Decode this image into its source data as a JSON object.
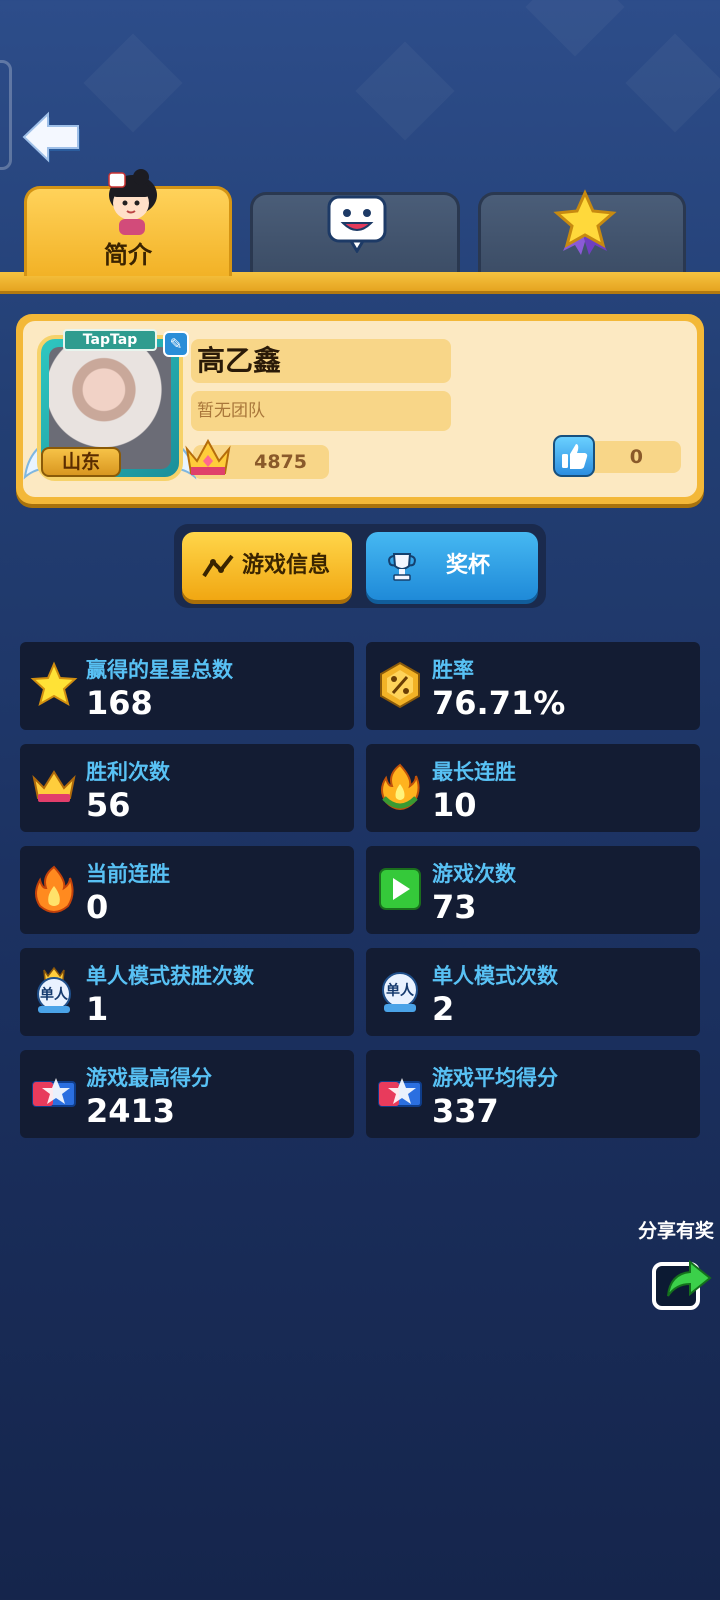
{
  "tabs": [
    {
      "label": "简介",
      "active": true,
      "icon": "character-avatar-icon"
    },
    {
      "label": "",
      "active": false,
      "icon": "smiley-chat-icon"
    },
    {
      "label": "",
      "active": false,
      "icon": "star-medal-icon"
    }
  ],
  "profile": {
    "platform_tag": "TapTap",
    "name": "高乙鑫",
    "team": "暂无团队",
    "region": "山东",
    "crowns": "4875",
    "likes": "0"
  },
  "subtabs": {
    "game_info": "游戏信息",
    "trophies": "奖杯"
  },
  "stats": [
    {
      "label": "赢得的星星总数",
      "value": "168",
      "icon": "star-icon"
    },
    {
      "label": "胜率",
      "value": "76.71%",
      "icon": "percent-badge-icon"
    },
    {
      "label": "胜利次数",
      "value": "56",
      "icon": "crown-icon"
    },
    {
      "label": "最长连胜",
      "value": "10",
      "icon": "fire-wreath-icon"
    },
    {
      "label": "当前连胜",
      "value": "0",
      "icon": "flame-icon"
    },
    {
      "label": "游戏次数",
      "value": "73",
      "icon": "play-icon"
    },
    {
      "label": "单人模式获胜次数",
      "value": "1",
      "icon": "solo-crown-icon"
    },
    {
      "label": "单人模式次数",
      "value": "2",
      "icon": "solo-icon"
    },
    {
      "label": "游戏最高得分",
      "value": "2413",
      "icon": "score-badge-icon"
    },
    {
      "label": "游戏平均得分",
      "value": "337",
      "icon": "score-badge-icon"
    }
  ],
  "share": {
    "label": "分享有奖"
  },
  "colors": {
    "accent_gold": "#f2b226",
    "stat_label": "#58c1f4",
    "card_bg": "#131c33"
  }
}
